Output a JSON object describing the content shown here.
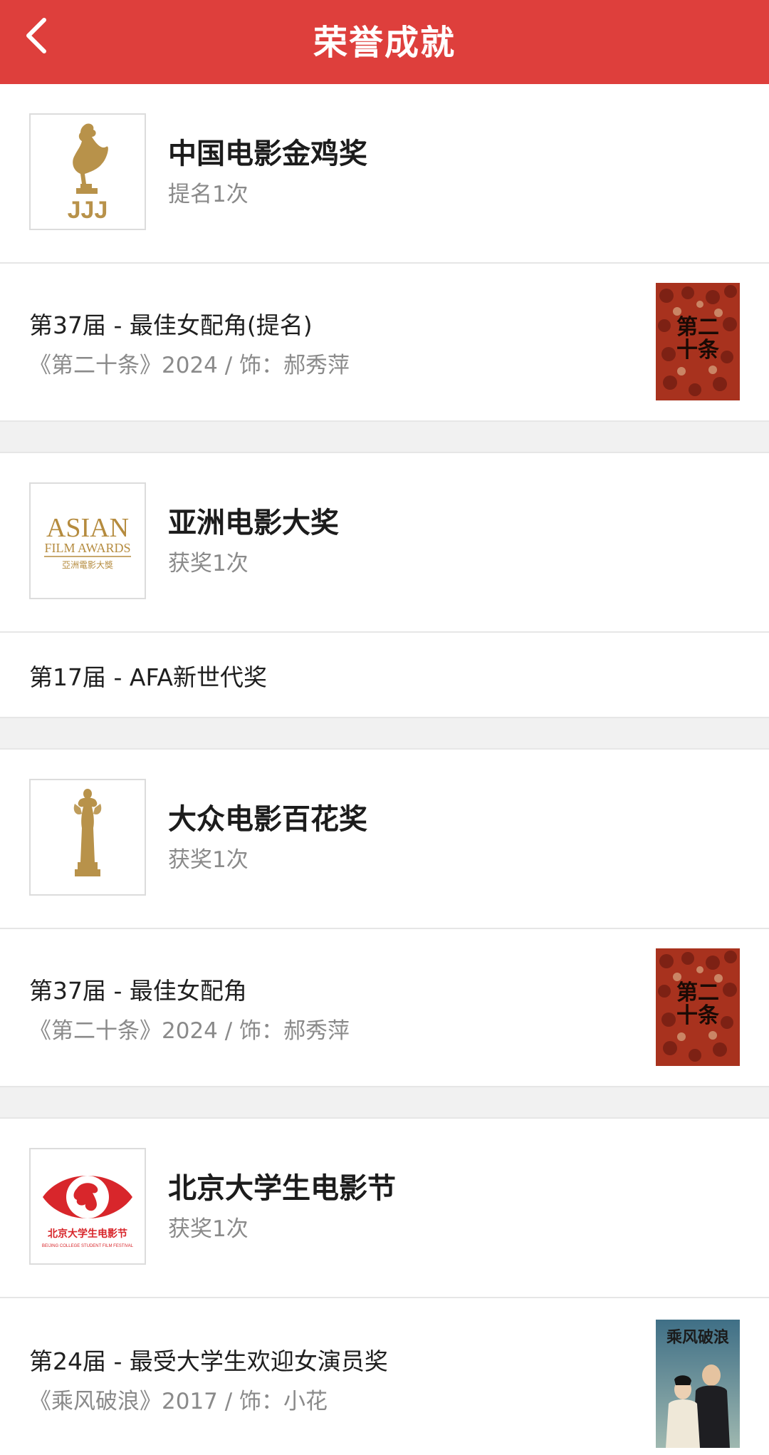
{
  "header": {
    "title": "荣誉成就"
  },
  "awards": [
    {
      "name": "中国电影金鸡奖",
      "count": "提名1次",
      "logo_text": "JJJ",
      "items": [
        {
          "title": "第37届 - 最佳女配角(提名)",
          "sub": "《第二十条》2024 / 饰：郝秀萍",
          "poster": "第二十条"
        }
      ]
    },
    {
      "name": "亚洲电影大奖",
      "count": "获奖1次",
      "logo_text": {
        "line1": "ASIAN",
        "line2": "FILM AWARDS",
        "line3": "亞洲電影大獎"
      },
      "items": [
        {
          "title": "第17届 - AFA新世代奖"
        }
      ]
    },
    {
      "name": "大众电影百花奖",
      "count": "获奖1次",
      "items": [
        {
          "title": "第37届 - 最佳女配角",
          "sub": "《第二十条》2024 / 饰：郝秀萍",
          "poster": "第二十条"
        }
      ]
    },
    {
      "name": "北京大学生电影节",
      "count": "获奖1次",
      "logo_text": {
        "line1": "北京大学生电影节",
        "line2": "BEIJING COLLEGE STUDENT FILM FESTIVAL"
      },
      "items": [
        {
          "title": "第24届 - 最受大学生欢迎女演员奖",
          "sub": "《乘风破浪》2017 / 饰：小花",
          "poster": "乘风破浪"
        }
      ]
    }
  ]
}
